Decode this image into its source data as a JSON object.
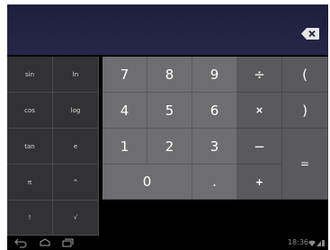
{
  "display": {
    "value": ""
  },
  "advanced_keys": [
    {
      "label": "sin"
    },
    {
      "label": "ln"
    },
    {
      "label": "cos"
    },
    {
      "label": "log"
    },
    {
      "label": "tan"
    },
    {
      "label": "e"
    },
    {
      "label": "π"
    },
    {
      "label": "^"
    },
    {
      "label": "!"
    },
    {
      "label": "√"
    }
  ],
  "digits": {
    "k7": "7",
    "k8": "8",
    "k9": "9",
    "k4": "4",
    "k5": "5",
    "k6": "6",
    "k1": "1",
    "k2": "2",
    "k3": "3",
    "k0": "0",
    "dot": "."
  },
  "operators": {
    "divide": "÷",
    "multiply": "×",
    "minus": "−",
    "plus": "+",
    "open_paren": "(",
    "close_paren": ")",
    "equals": "="
  },
  "status_bar": {
    "time": "18:36"
  },
  "icons": {
    "backspace": "backspace-icon",
    "back": "back-icon",
    "home": "home-icon",
    "recents": "recent-apps-icon",
    "wifi": "wifi-icon",
    "signal": "signal-icon",
    "battery": "battery-icon"
  },
  "colors": {
    "display_bg": "#22223f",
    "advanced_bg": "#323234",
    "digit_bg": "#6e6e70",
    "operator_bg": "#5a5a5c"
  }
}
